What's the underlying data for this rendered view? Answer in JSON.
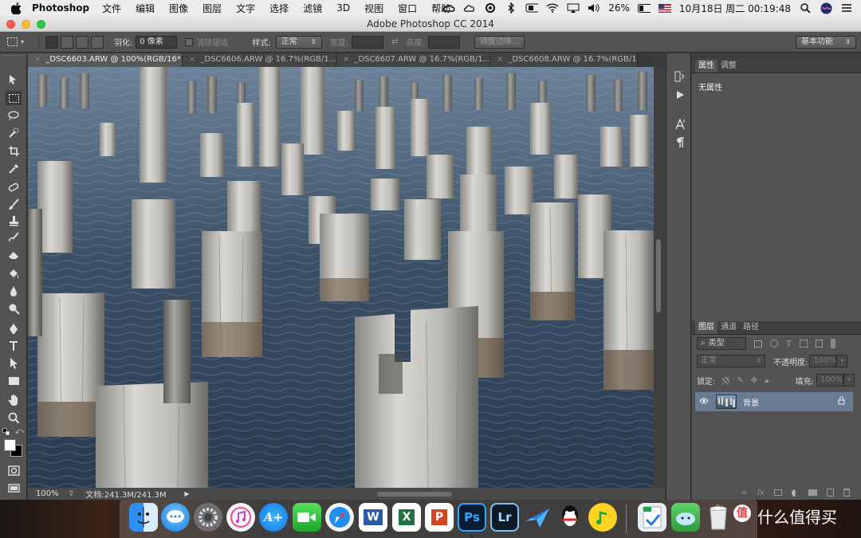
{
  "menubar": {
    "app_name": "Photoshop",
    "items": [
      "文件",
      "编辑",
      "图像",
      "图层",
      "文字",
      "选择",
      "滤镜",
      "3D",
      "视图",
      "窗口",
      "帮助"
    ],
    "battery": "26%",
    "datetime": "10月18日 周二  00:19:48"
  },
  "window": {
    "title": "Adobe Photoshop CC 2014"
  },
  "options": {
    "feather_label": "羽化:",
    "feather_value": "0 像素",
    "antialias_label": "消除锯齿",
    "style_label": "样式:",
    "style_value": "正常",
    "width_label": "宽度:",
    "height_label": "高度:",
    "refine_edge": "调整边缘...",
    "workspace": "基本功能"
  },
  "tabs": [
    {
      "label": "_DSC6603.ARW @ 100%(RGB/16*)",
      "active": true
    },
    {
      "label": "_DSC6606.ARW @ 16.7%(RGB/1...",
      "active": false
    },
    {
      "label": "_DSC6607.ARW @ 16.7%(RGB/1...",
      "active": false
    },
    {
      "label": "_DSC6608.ARW @ 16.7%(RGB/1...",
      "active": false
    }
  ],
  "status": {
    "zoom": "100%",
    "doc_size": "文档:241.3M/241.3M"
  },
  "properties": {
    "tabs": [
      "属性",
      "调整"
    ],
    "empty_text": "无属性"
  },
  "layers": {
    "tabs": [
      "图层",
      "通道",
      "路径"
    ],
    "filter_kind": "类型",
    "blend_mode": "正常",
    "opacity_label": "不透明度:",
    "opacity_value": "100%",
    "lock_label": "锁定:",
    "fill_label": "填充:",
    "fill_value": "100%",
    "layer_name": "背景"
  },
  "dock": {
    "apps": [
      "finder-icon",
      "messages-icon",
      "system-preferences-icon",
      "itunes-icon",
      "app-store-icon",
      "facetime-icon",
      "safari-icon",
      "word-icon",
      "excel-icon",
      "powerpoint-icon",
      "photoshop-icon",
      "lightroom-icon",
      "feishu-icon",
      "qq-icon",
      "qq-music-icon",
      "bt-download-icon",
      "weiyun-icon",
      "trash-icon"
    ],
    "ps_label": "Ps",
    "lr_label": "Lr",
    "watermark": "什么值得买"
  }
}
